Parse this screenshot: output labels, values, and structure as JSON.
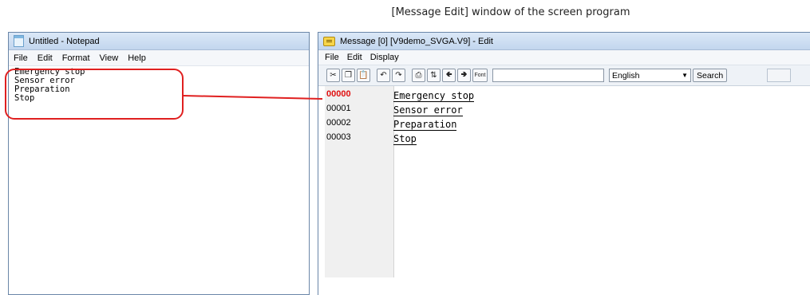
{
  "caption": "[Message Edit] window of the screen program",
  "notepad": {
    "title": "Untitled - Notepad",
    "menu": [
      "File",
      "Edit",
      "Format",
      "View",
      "Help"
    ],
    "lines": [
      "Emergency stop",
      "Sensor error",
      "Preparation",
      "Stop"
    ]
  },
  "message_edit": {
    "title": "Message [0] [V9demo_SVGA.V9] - Edit",
    "menu": [
      "File",
      "Edit",
      "Display"
    ],
    "toolbar": {
      "font_label": "Font",
      "search_value": "",
      "language": "English",
      "search_label": "Search"
    },
    "rows": [
      {
        "number": "00000",
        "text": "Emergency stop"
      },
      {
        "number": "00001",
        "text": "Sensor error"
      },
      {
        "number": "00002",
        "text": "Preparation"
      },
      {
        "number": "00003",
        "text": "Stop"
      }
    ]
  },
  "highlight_color": "#e02020",
  "icons": [
    "notepad-icon",
    "message-icon",
    "cut-icon",
    "copy-icon",
    "paste-icon",
    "undo-icon",
    "redo-icon",
    "print-icon",
    "jump-icon",
    "arrow-left-icon",
    "arrow-right-icon",
    "dropdown-arrow-icon"
  ]
}
